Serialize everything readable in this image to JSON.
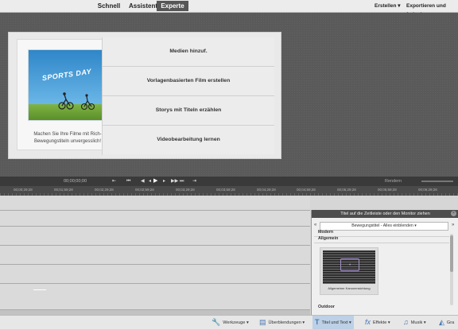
{
  "topbar": {
    "tabs": [
      {
        "label": "Schnell",
        "active": false
      },
      {
        "label": "Assistent",
        "active": false
      },
      {
        "label": "Experte",
        "active": true
      }
    ],
    "menus": [
      "Erstellen ▾",
      "Exportieren und freigeben"
    ]
  },
  "welcome": {
    "thumbnail_title": "SPORTS DAY",
    "description": "Machen Sie Ihre Filme mit Rich-Bewegungstiteln unvergesslich!",
    "options": [
      "Medien hinzuf.",
      "Vorlagenbasierten Film erstellen",
      "Storys mit Titeln erzählen",
      "Videobearbeitung lernen"
    ]
  },
  "playback": {
    "timecode": "00;00;00;00",
    "buttons": [
      "⇤",
      "⏮",
      "◀",
      "◂",
      "▶",
      "▸",
      "▶▶",
      "⏭",
      "⇥"
    ],
    "render_label": "Rendern"
  },
  "ruler": {
    "labels": [
      "00;00;29;28",
      "00;01;59;28",
      "00;02;29;28",
      "00;02;59;28",
      "00;03;29;28",
      "00;03;59;28",
      "00;04;29;28",
      "00;04;59;28",
      "00;05;29;28",
      "00;05;59;28",
      "00;06;29;28"
    ]
  },
  "panel": {
    "header": "Titel auf die Zeitleiste oder den Monitor ziehen",
    "close_glyph": "×",
    "select_value": "Bewegungstitel - Alles einblenden",
    "categories": [
      "Modern",
      "Allgemein",
      "Outdoor"
    ],
    "item_label": "Allgemeiner Kanonensichtung"
  },
  "bottombar": {
    "items": [
      {
        "icon": "🔧",
        "label": "Werkzeuge ▾",
        "active": false
      },
      {
        "icon": "▤",
        "label": "Überblendungen ▾",
        "active": false
      },
      {
        "icon": "T",
        "label": "Titel und Text ▾",
        "active": true
      },
      {
        "icon": "fx",
        "label": "Effekte ▾",
        "active": false
      },
      {
        "icon": "♫",
        "label": "Musik ▾",
        "active": false
      },
      {
        "icon": "◭",
        "label": "Gra",
        "active": false
      }
    ]
  },
  "colors": {
    "active_tab": "#575757",
    "preview_bg": "#5a5a5a",
    "active_bottom_item": "#bcd0e6"
  }
}
